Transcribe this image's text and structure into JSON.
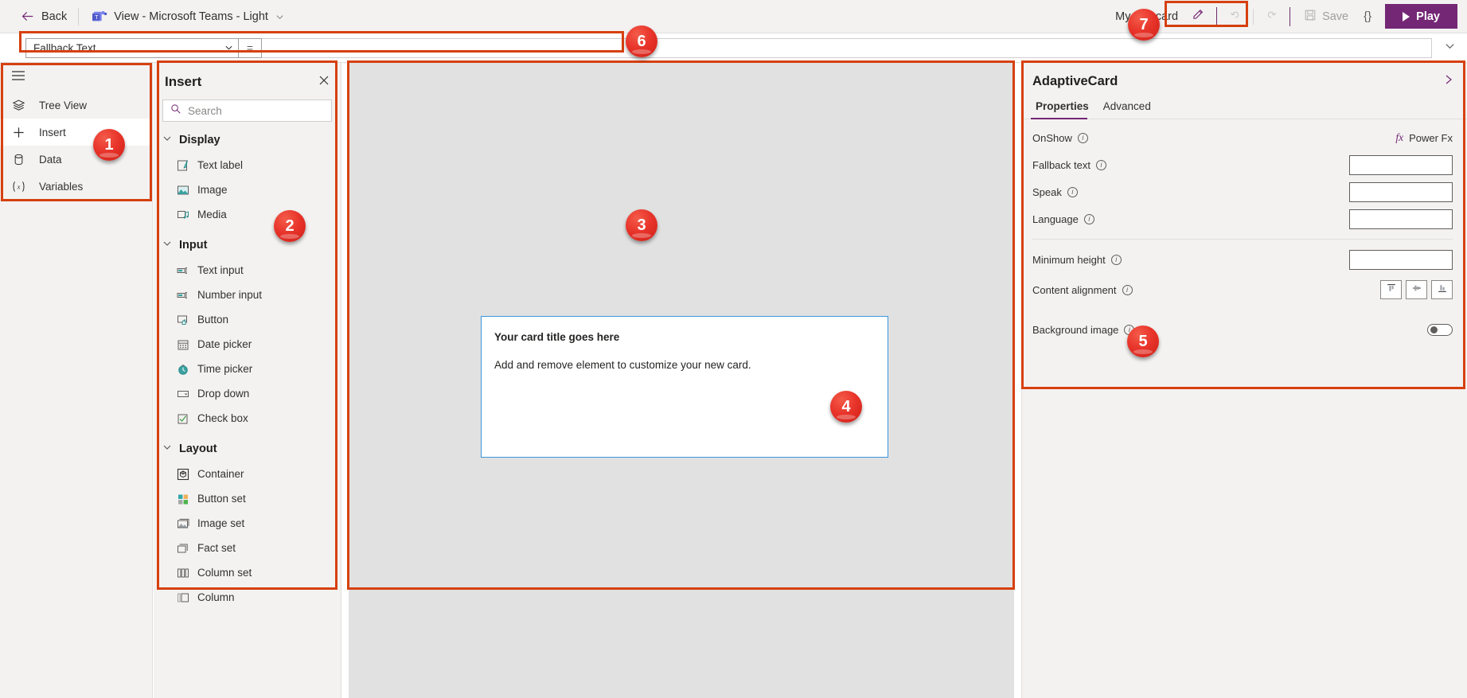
{
  "topbar": {
    "back_label": "Back",
    "app_title": "View - Microsoft Teams - Light",
    "card_name": "My first card",
    "save_label": "Save",
    "json_label": "{}",
    "play_label": "Play",
    "icons": {
      "back": "back-arrow-icon",
      "teams": "microsoft-teams-icon",
      "title_chevron": "chevron-down-icon",
      "edit": "pencil-edit-icon",
      "undo": "undo-icon",
      "redo": "redo-icon",
      "save": "save-disk-icon",
      "json": "curly-braces-icon",
      "play": "play-triangle-icon"
    }
  },
  "formula_bar": {
    "property": "Fallback Text",
    "equals": "=",
    "value": "",
    "expand_icon": "chevron-down-icon",
    "dropdown_icon": "chevron-down-icon"
  },
  "rail": {
    "menu_icon": "hamburger-menu-icon",
    "items": [
      {
        "label": "Tree View",
        "icon": "layers-icon",
        "active": false
      },
      {
        "label": "Insert",
        "icon": "plus-icon",
        "active": true
      },
      {
        "label": "Data",
        "icon": "database-icon",
        "active": false
      },
      {
        "label": "Variables",
        "icon": "variable-x-icon",
        "active": false
      }
    ]
  },
  "insert": {
    "title": "Insert",
    "close_icon": "close-icon",
    "search_placeholder": "Search",
    "search_value": "",
    "search_icon": "search-icon",
    "groups": [
      {
        "name": "Display",
        "expanded": true,
        "items": [
          {
            "label": "Text label",
            "icon": "text-label-icon"
          },
          {
            "label": "Image",
            "icon": "image-icon"
          },
          {
            "label": "Media",
            "icon": "media-icon"
          }
        ]
      },
      {
        "name": "Input",
        "expanded": true,
        "items": [
          {
            "label": "Text input",
            "icon": "text-input-icon"
          },
          {
            "label": "Number input",
            "icon": "number-input-icon"
          },
          {
            "label": "Button",
            "icon": "button-icon"
          },
          {
            "label": "Date picker",
            "icon": "calendar-icon"
          },
          {
            "label": "Time picker",
            "icon": "clock-icon"
          },
          {
            "label": "Drop down",
            "icon": "dropdown-icon"
          },
          {
            "label": "Check box",
            "icon": "checkbox-icon"
          }
        ]
      },
      {
        "name": "Layout",
        "expanded": true,
        "items": [
          {
            "label": "Container",
            "icon": "container-icon"
          },
          {
            "label": "Button set",
            "icon": "button-set-icon"
          },
          {
            "label": "Image set",
            "icon": "image-set-icon"
          },
          {
            "label": "Fact set",
            "icon": "fact-set-icon"
          },
          {
            "label": "Column set",
            "icon": "column-set-icon"
          },
          {
            "label": "Column",
            "icon": "column-icon"
          }
        ]
      }
    ]
  },
  "card": {
    "title": "Your card title goes here",
    "body": "Add and remove element to customize your new card."
  },
  "properties": {
    "title": "AdaptiveCard",
    "collapse_icon": "chevron-right-icon",
    "tabs": [
      {
        "label": "Properties",
        "active": true
      },
      {
        "label": "Advanced",
        "active": false
      }
    ],
    "rows": [
      {
        "label": "OnShow",
        "control": "powerfx",
        "value": "Power Fx",
        "fx_symbol": "fx"
      },
      {
        "label": "Fallback text",
        "control": "text",
        "value": ""
      },
      {
        "label": "Speak",
        "control": "text",
        "value": ""
      },
      {
        "label": "Language",
        "control": "text",
        "value": ""
      },
      {
        "label": "Minimum height",
        "control": "text",
        "value": ""
      },
      {
        "label": "Content alignment",
        "control": "align",
        "options": [
          "align-top-icon",
          "align-middle-icon",
          "align-bottom-icon"
        ]
      },
      {
        "label": "Background image",
        "control": "toggle",
        "value": "off"
      }
    ]
  },
  "annotations": {
    "color": "#d6400f",
    "badges": [
      "1",
      "2",
      "3",
      "4",
      "5",
      "6",
      "7"
    ]
  }
}
